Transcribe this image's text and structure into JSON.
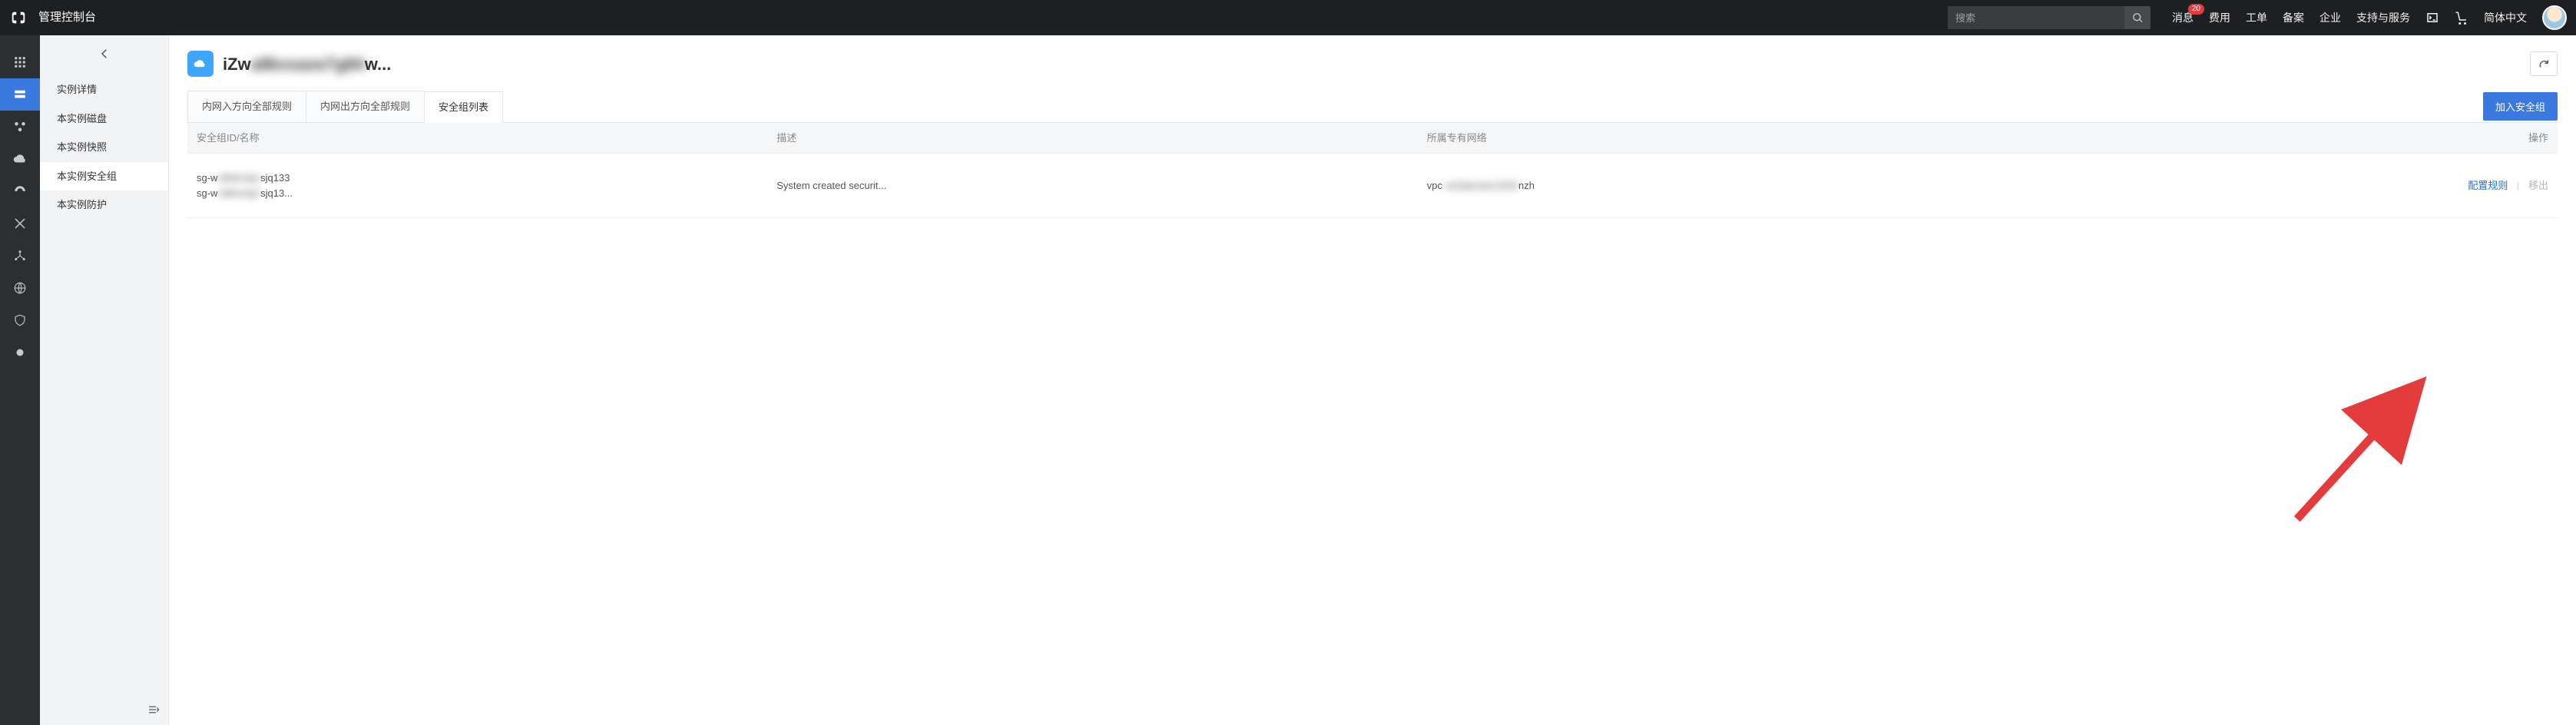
{
  "top": {
    "console_title": "管理控制台",
    "search_placeholder": "搜索",
    "nav": {
      "messages": "消息",
      "messages_badge": "20",
      "billing": "费用",
      "tickets": "工单",
      "icp": "备案",
      "enterprise": "企业",
      "support": "支持与服务",
      "lang": "简体中文"
    }
  },
  "side_menu": {
    "items": [
      "实例详情",
      "本实例磁盘",
      "本实例快照",
      "本实例安全组",
      "本实例防护"
    ]
  },
  "page": {
    "title_prefix": "iZw",
    "title_blur": "a8kvsaxe7g84",
    "title_suffix": "w..."
  },
  "tabs": {
    "inbound": "内网入方向全部规则",
    "outbound": "内网出方向全部规则",
    "list": "安全组列表"
  },
  "actions": {
    "join_sg": "加入安全组"
  },
  "table": {
    "headers": {
      "id_name": "安全组ID/名称",
      "desc": "描述",
      "vpc": "所属专有网络",
      "ops": "操作"
    },
    "row": {
      "sg_id_prefix": "sg-w",
      "sg_id_blur": "z9k6v3p2",
      "sg_id_suffix": "sjq133",
      "sg_name_prefix": "sg-w",
      "sg_name_blur": "z9k6v3p2",
      "sg_name_suffix": "sjq13...",
      "desc": "System created securit...",
      "vpc_prefix": "vpc",
      "vpc_blur": "-wz9abcde12345",
      "vpc_suffix": "nzh",
      "op_config": "配置规则",
      "op_remove": "移出"
    }
  }
}
